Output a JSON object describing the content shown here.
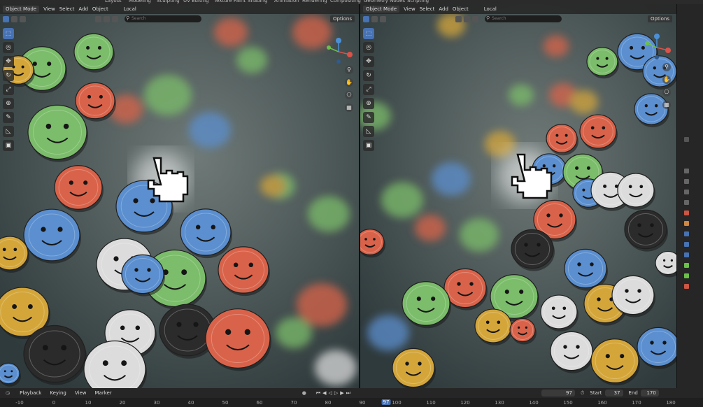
{
  "top_menu": [
    "Layout",
    "Modeling",
    "Sculpting",
    "UV Editing",
    "Texture Paint",
    "Shading",
    "Animation",
    "Rendering",
    "Compositing",
    "Geometry Nodes",
    "Scripting"
  ],
  "viewport_left": {
    "mode": "Object Mode",
    "menu": [
      "View",
      "Select",
      "Add",
      "Object"
    ],
    "transform": "Local",
    "search_placeholder": "Search",
    "options": "Options"
  },
  "viewport_right": {
    "mode": "Object Mode",
    "menu": [
      "View",
      "Select",
      "Add",
      "Object"
    ],
    "transform": "Local",
    "search_placeholder": "Search",
    "options": "Options"
  },
  "timeline": {
    "playback": "Playback",
    "keying": "Keying",
    "view": "View",
    "marker": "Marker",
    "current_frame": "97",
    "start_label": "Start",
    "start": "37",
    "end_label": "End",
    "end": "170",
    "ruler": [
      "-10",
      "0",
      "10",
      "20",
      "30",
      "40",
      "50",
      "60",
      "70",
      "80",
      "90",
      "100",
      "110",
      "120",
      "130",
      "140",
      "150",
      "160",
      "170",
      "180"
    ],
    "playhead": "97"
  },
  "colors": {
    "accent": "#4772b3",
    "coin_red": "#d9634a",
    "coin_blue": "#5b8fcf",
    "coin_green": "#7bbd6a",
    "coin_yellow": "#d4a63a",
    "coin_white": "#dcdcdc",
    "coin_dark": "#2b2b2b"
  },
  "icons": [
    "select-box-icon",
    "cursor-icon",
    "move-icon",
    "rotate-icon",
    "scale-icon",
    "transform-icon",
    "annotate-icon",
    "measure-icon",
    "add-cube-icon",
    "hand-pointer-icon",
    "zoom-icon",
    "pan-icon",
    "camera-icon",
    "grid-icon"
  ]
}
